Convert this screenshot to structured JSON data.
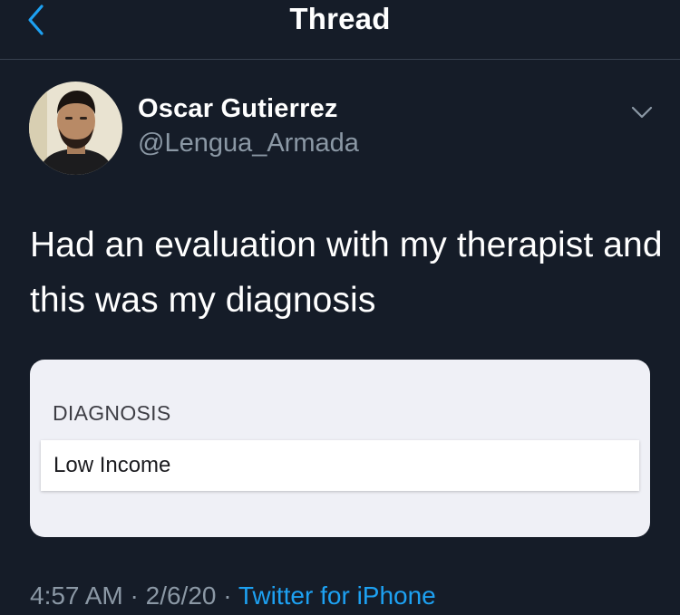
{
  "nav": {
    "title": "Thread",
    "back_icon": "chevron-left-icon"
  },
  "tweet": {
    "author_name": "Oscar Gutierrez",
    "author_handle": "@Lengua_Armada",
    "more_icon": "chevron-down-icon",
    "text": "Had an evaluation with my therapist and this was my diagnosis",
    "media": {
      "label": "DIAGNOSIS",
      "value": "Low Income"
    },
    "time": "4:57 AM",
    "separator": "·",
    "date": "2/6/20",
    "source": "Twitter for iPhone"
  },
  "colors": {
    "background": "#151c28",
    "accent": "#1da1f2",
    "secondary_text": "#8b98a5",
    "divider": "#38414f"
  }
}
